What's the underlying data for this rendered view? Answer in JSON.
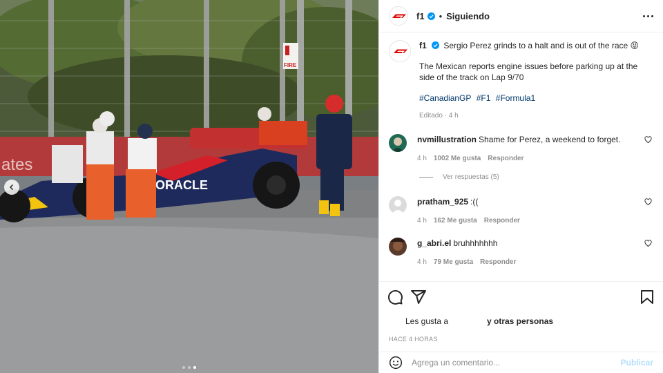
{
  "media": {
    "scene_labels": {
      "fire_sign": "FIRE",
      "wall_text": "ates",
      "car_sponsor": "ORACLE"
    },
    "carousel": {
      "dot_count": 3,
      "active_dot": 3
    }
  },
  "header": {
    "username": "f1",
    "separator": "•",
    "follow_status": "Siguiendo"
  },
  "caption": {
    "username": "f1",
    "text": "Sergio Perez grinds to a halt and is out of the race",
    "emoji": "😝",
    "paragraph": "The Mexican reports engine issues before parking up at the side of the track on Lap 9/70",
    "hashtags": [
      "#CanadianGP",
      "#F1",
      "#Formula1"
    ],
    "edited": "Editado · 4 h"
  },
  "comments": [
    {
      "username": "nvmillustration",
      "text": "Shame for Perez, a weekend to forget.",
      "time": "4 h",
      "likes": "1002 Me gusta",
      "reply": "Responder",
      "avatar_color": "#1e6a55"
    },
    {
      "username": "pratham_925",
      "text": ":((",
      "time": "4 h",
      "likes": "162 Me gusta",
      "reply": "Responder",
      "avatar_color": "#dbdbdb"
    },
    {
      "username": "g_abri.el",
      "text": "bruhhhhhhh",
      "time": "4 h",
      "likes": "79 Me gusta",
      "reply": "Responder",
      "avatar_color": "#5a3a2a"
    }
  ],
  "view_replies": "Ver respuestas (5)",
  "likes_line": {
    "part1": "Les gusta a",
    "part2": "y otras personas"
  },
  "time_ago": "HACE 4 HORAS",
  "add_comment": {
    "placeholder": "Agrega un comentario...",
    "publish": "Publicar"
  },
  "colors": {
    "link": "#00376b",
    "verified": "#0095f6",
    "muted": "#8e8e8e",
    "publish_disabled": "#b2dffc",
    "f1_red": "#e10600"
  },
  "icons": [
    "chevron-left-icon",
    "verified-badge-icon",
    "more-options-icon",
    "heart-icon",
    "comment-icon",
    "share-icon",
    "bookmark-icon",
    "emoji-icon"
  ]
}
